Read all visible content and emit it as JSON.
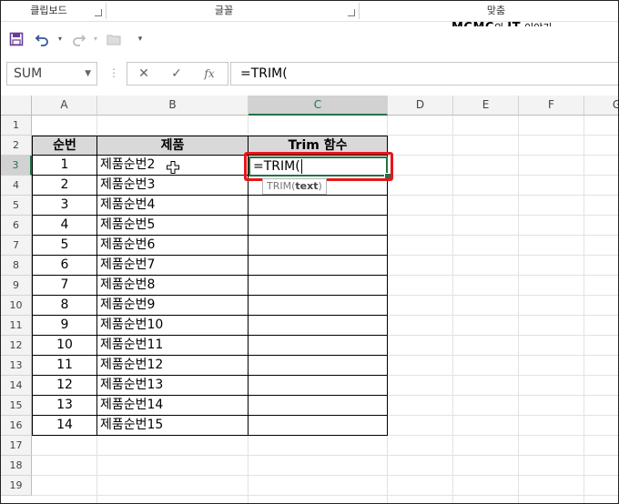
{
  "ribbon": {
    "groups": [
      "클립보드",
      "글꼴",
      "맞춤"
    ]
  },
  "brand": {
    "name": "MCMC",
    "connector": "의",
    "highlight": "IT",
    "suffix": "이야기"
  },
  "quick_access": {
    "icons": [
      "save-icon",
      "undo-icon",
      "redo-icon",
      "open-icon",
      "customize-icon"
    ]
  },
  "formula_bar": {
    "name_box": "SUM",
    "cancel": "✕",
    "enter": "✓",
    "fx": "fx",
    "content": "=TRIM("
  },
  "columns": [
    "A",
    "B",
    "C",
    "D",
    "E",
    "F",
    "G"
  ],
  "rows": [
    "1",
    "2",
    "3",
    "4",
    "5",
    "6",
    "7",
    "8",
    "9",
    "10",
    "11",
    "12",
    "13",
    "14",
    "15",
    "16",
    "17",
    "18",
    "19"
  ],
  "table": {
    "headers": [
      "순번",
      "제품",
      "Trim 함수"
    ],
    "rows": [
      {
        "num": "1",
        "product": "제품순번2"
      },
      {
        "num": "2",
        "product": "제품순번3"
      },
      {
        "num": "3",
        "product": "제품순번4"
      },
      {
        "num": "4",
        "product": "제품순번5"
      },
      {
        "num": "5",
        "product": "제품순번6"
      },
      {
        "num": "6",
        "product": "제품순번7"
      },
      {
        "num": "7",
        "product": "제품순번8"
      },
      {
        "num": "8",
        "product": "제품순번9"
      },
      {
        "num": "9",
        "product": "제품순번10"
      },
      {
        "num": "10",
        "product": "제품순번11"
      },
      {
        "num": "11",
        "product": "제품순번12"
      },
      {
        "num": "12",
        "product": "제품순번13"
      },
      {
        "num": "13",
        "product": "제품순번14"
      },
      {
        "num": "14",
        "product": "제품순번15"
      }
    ]
  },
  "active_cell": {
    "ref": "C3",
    "value": "=TRIM("
  },
  "tooltip": {
    "func": "TRIM(",
    "arg": "text",
    "close": ")"
  },
  "colors": {
    "accent": "#217346",
    "highlight": "#e8151a",
    "header_fill": "#d9d9d9"
  }
}
